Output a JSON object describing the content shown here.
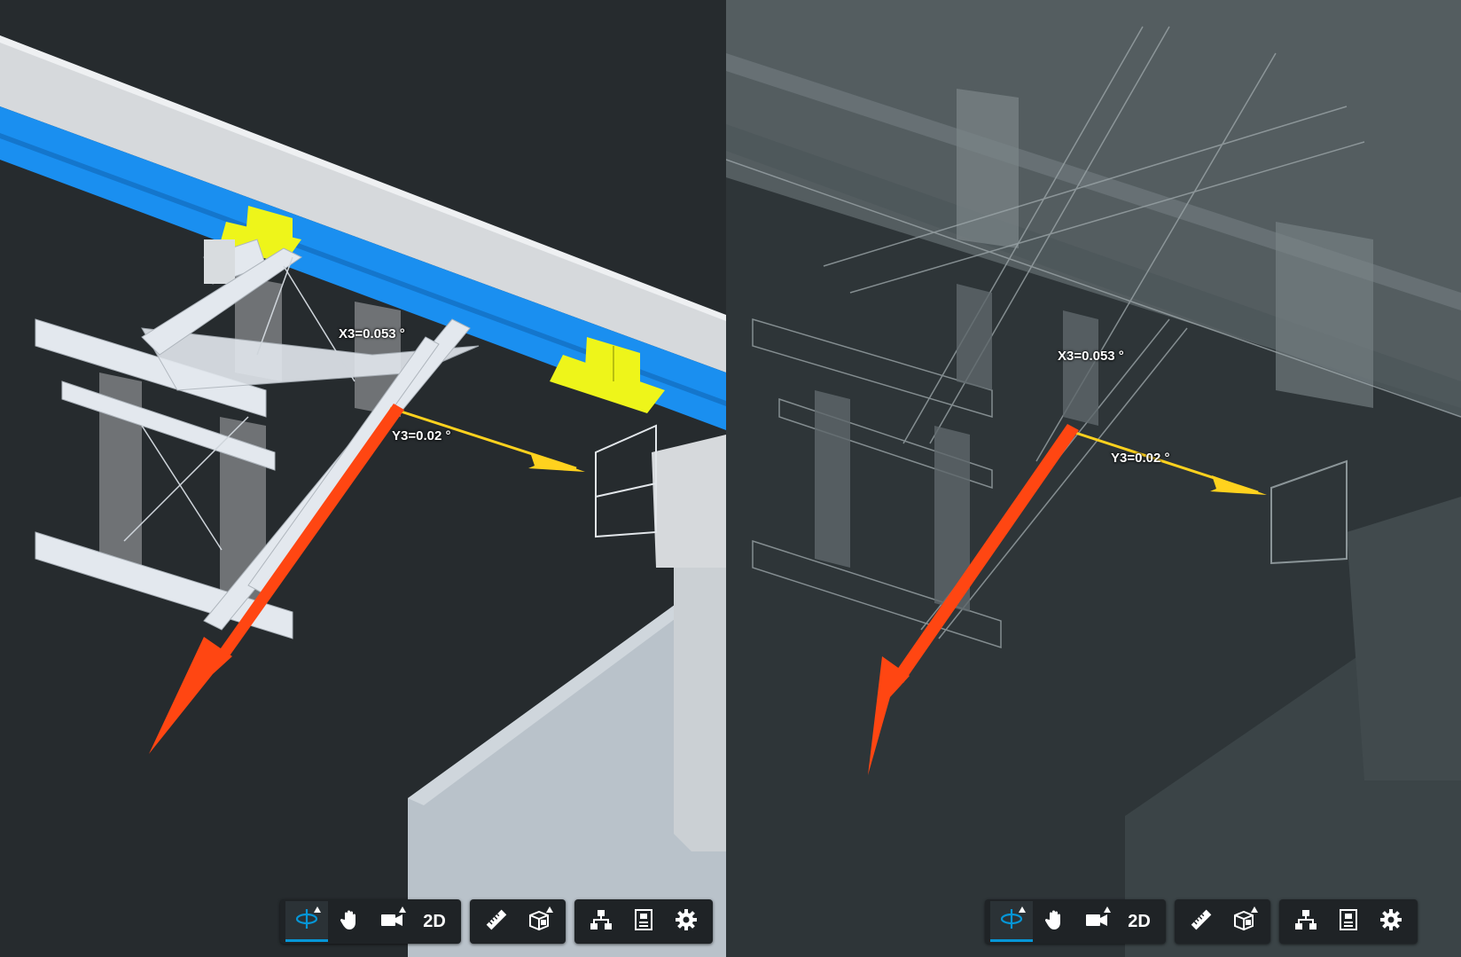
{
  "left_view": {
    "x_angle_label": "X3=0.053 °",
    "y_angle_label": "Y3=0.02 °"
  },
  "right_view": {
    "x_angle_label": "X3=0.053 °",
    "y_angle_label": "Y3=0.02 °"
  },
  "toolbar": {
    "groups": [
      {
        "tools": [
          {
            "name": "orbit-tool",
            "icon": "orbit-icon",
            "active": true,
            "has_menu": true
          },
          {
            "name": "pan-tool",
            "icon": "hand-icon",
            "active": false,
            "has_menu": false
          },
          {
            "name": "camera-tool",
            "icon": "camera-icon",
            "active": false,
            "has_menu": true
          },
          {
            "name": "2d-tool",
            "label": "2D",
            "active": false,
            "has_menu": false
          }
        ]
      },
      {
        "tools": [
          {
            "name": "measure-tool",
            "icon": "ruler-icon",
            "has_menu": false
          },
          {
            "name": "section-tool",
            "icon": "section-box-icon",
            "has_menu": true
          }
        ]
      },
      {
        "tools": [
          {
            "name": "model-browser-tool",
            "icon": "hierarchy-icon",
            "has_menu": false
          },
          {
            "name": "properties-tool",
            "icon": "properties-icon",
            "has_menu": false
          },
          {
            "name": "settings-tool",
            "icon": "gear-icon",
            "has_menu": false
          }
        ]
      }
    ],
    "two_d_label": "2D"
  },
  "colors": {
    "background": "#262b2e",
    "beam_blue": "#1a8ff0",
    "highlight_yellow": "#eef51a",
    "x_axis_arrow": "#ff4612",
    "y_axis_arrow": "#ffd21e",
    "accent": "#0696d7"
  }
}
